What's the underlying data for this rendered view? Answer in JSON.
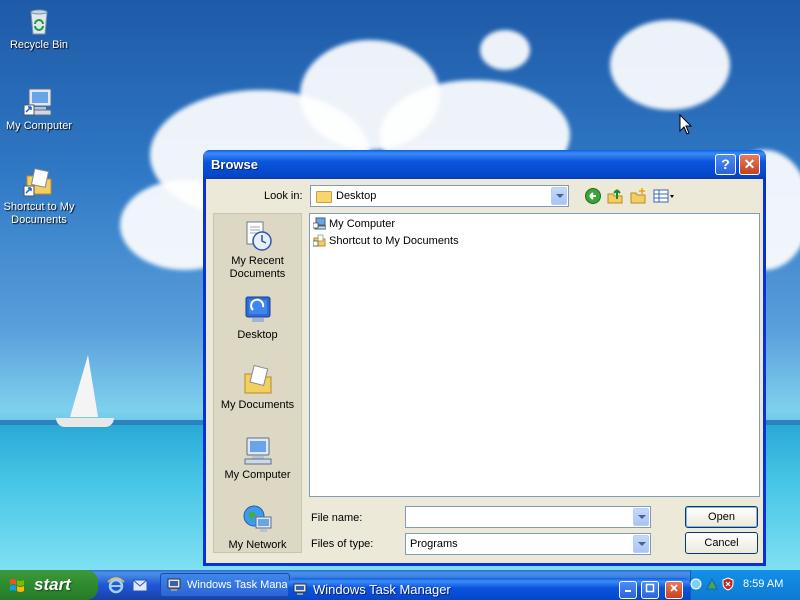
{
  "desktop": {
    "icons": [
      {
        "label": "Recycle Bin",
        "icon": "recycle-bin-icon"
      },
      {
        "label": "My Computer",
        "icon": "my-computer-icon"
      },
      {
        "label": "Shortcut to My Documents",
        "icon": "my-documents-shortcut-icon"
      }
    ]
  },
  "dialog": {
    "title": "Browse",
    "help_button": "?",
    "close_button": "✕",
    "look_in_label": "Look in:",
    "look_in_value": "Desktop",
    "places": [
      {
        "label": "My Recent Documents",
        "icon": "recent-documents-icon"
      },
      {
        "label": "Desktop",
        "icon": "desktop-icon"
      },
      {
        "label": "My Documents",
        "icon": "my-documents-icon"
      },
      {
        "label": "My Computer",
        "icon": "my-computer-icon"
      },
      {
        "label": "My Network",
        "icon": "my-network-icon"
      }
    ],
    "files": [
      "My Computer",
      "Shortcut to My Documents"
    ],
    "file_name_label": "File name:",
    "file_name_value": "",
    "files_of_type_label": "Files of type:",
    "files_of_type_value": "Programs",
    "open_button": "Open",
    "cancel_button": "Cancel"
  },
  "taskbar": {
    "start_label": "start",
    "task_label": "Windows Task Manag",
    "clock": "8:59 AM"
  },
  "task_manager_window": {
    "title": "Windows Task Manager"
  },
  "colors": {
    "title_bar": "#0a55de",
    "dialog_bg": "#ece9d8",
    "start_green": "#2e8b2e",
    "taskbar_blue": "#2157d7"
  }
}
